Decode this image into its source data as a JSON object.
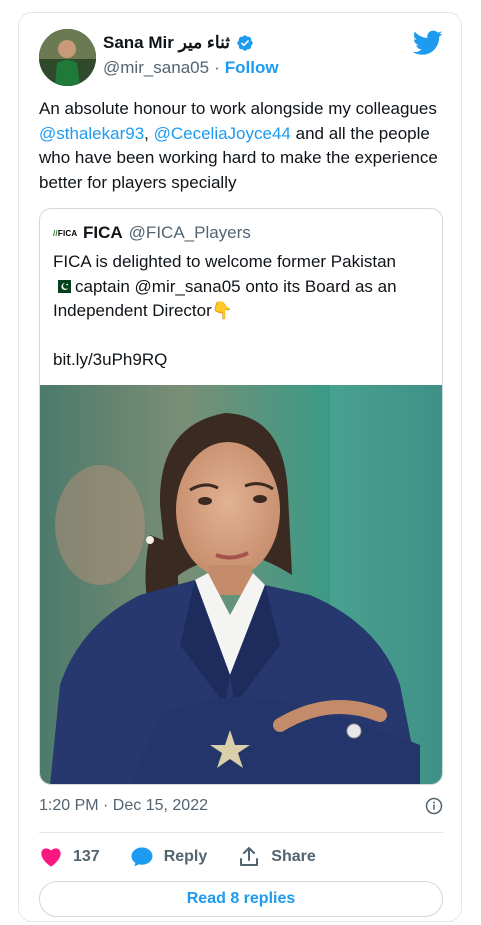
{
  "author": {
    "display_name": "Sana Mir ثناء میر",
    "handle": "@mir_sana05",
    "separator": "·",
    "follow_label": "Follow"
  },
  "tweet": {
    "text_before": "An absolute honour to work alongside my colleagues ",
    "mention_1": "@sthalekar93",
    "comma": ", ",
    "mention_2": "@CeceliaJoyce44",
    "text_after": " and all the people who have been working hard to make the experience better for players specially"
  },
  "quoted": {
    "logo_text": "FICA",
    "display_name": "FICA",
    "handle": "@FICA_Players",
    "line_1": "FICA is delighted to welcome former Pakistan",
    "line_2": "captain @mir_sana05 onto its Board as an Independent Director",
    "emoji": "👇",
    "link": "bit.ly/3uPh9RQ"
  },
  "meta": {
    "timestamp": "1:20 PM · Dec 15, 2022"
  },
  "actions": {
    "like_count": "137",
    "reply_label": "Reply",
    "share_label": "Share"
  },
  "read_replies_label": "Read 8 replies",
  "colors": {
    "accent": "#1d9bf0",
    "like": "#f91880",
    "text": "#0f1419",
    "muted": "#536471"
  },
  "icons": [
    "verified-badge-icon",
    "twitter-bird-icon",
    "pakistan-flag-icon",
    "info-icon",
    "heart-icon",
    "reply-bubble-icon",
    "share-icon"
  ]
}
